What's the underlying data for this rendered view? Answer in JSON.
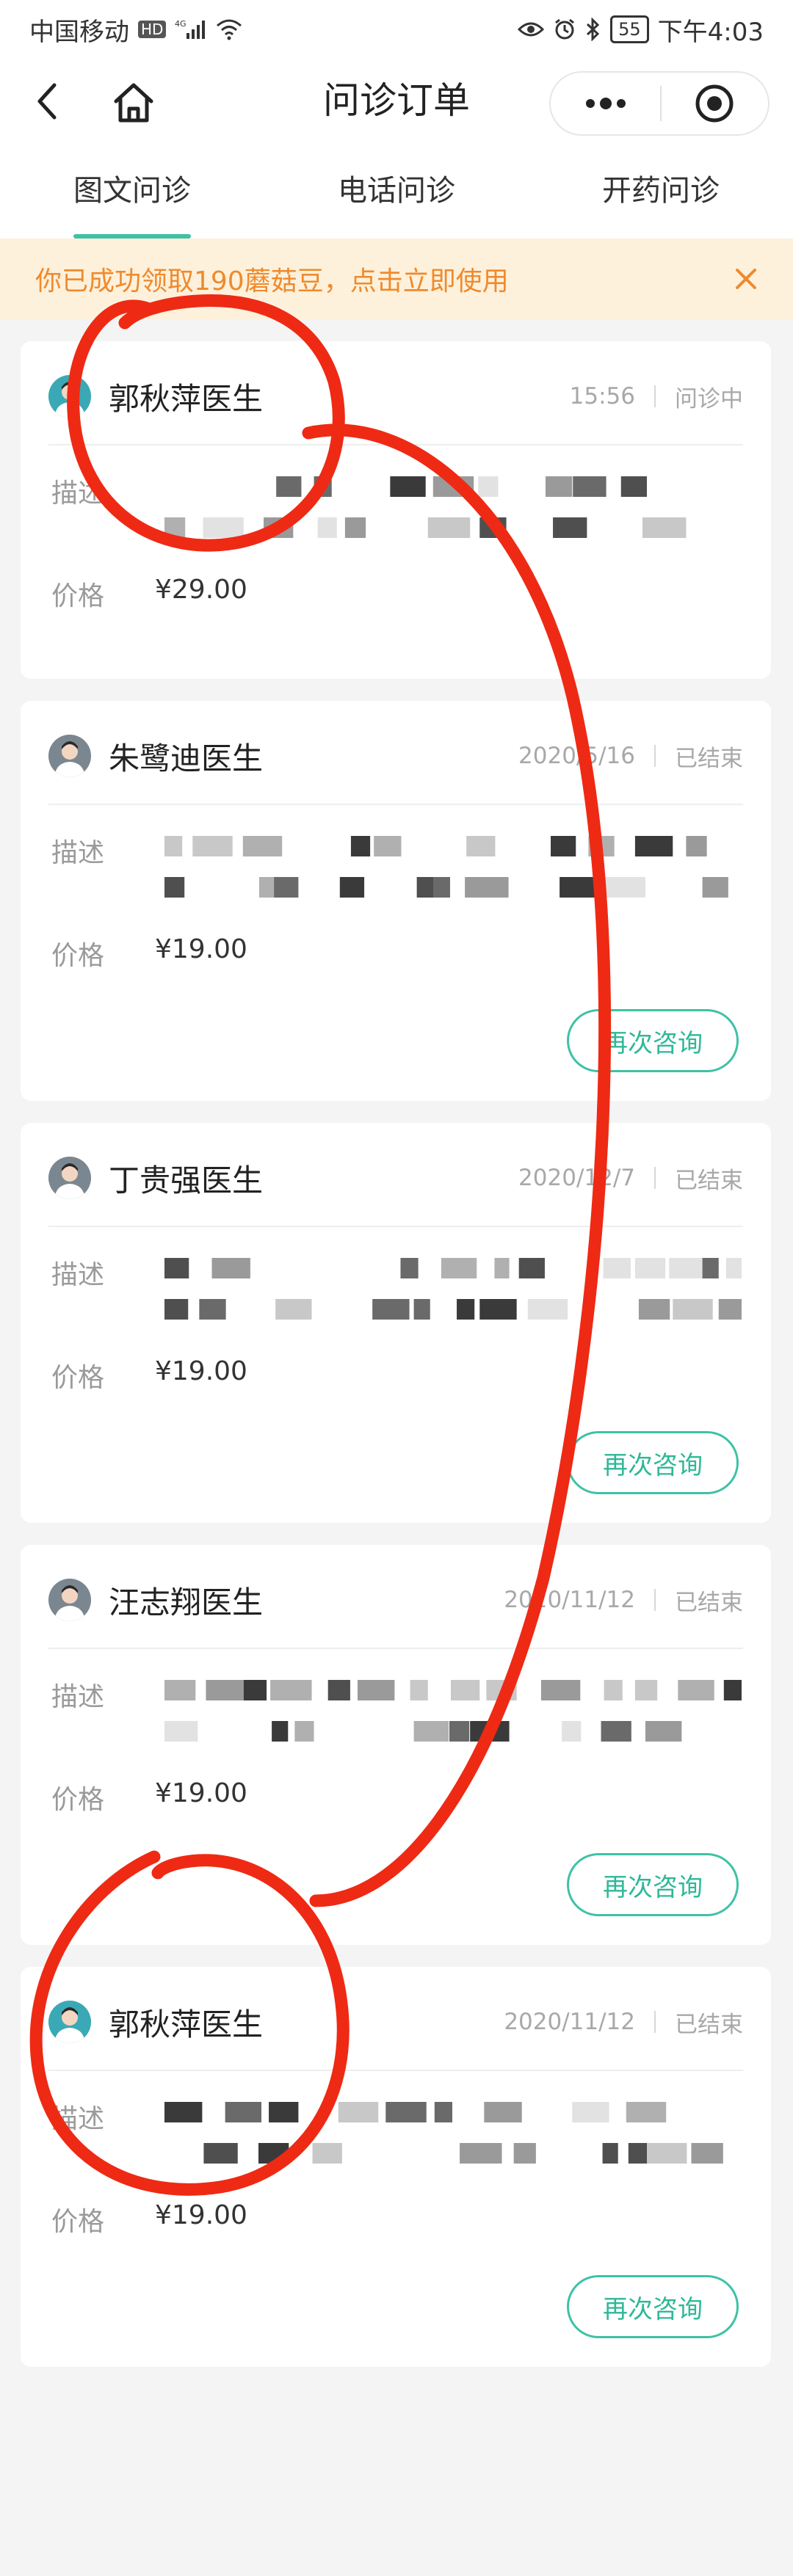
{
  "status_bar": {
    "carrier": "中国移动",
    "hd": "HD",
    "network": "4G",
    "battery": "55",
    "time": "下午4:03"
  },
  "nav": {
    "title": "问诊订单"
  },
  "tabs": [
    {
      "label": "图文问诊",
      "active": true
    },
    {
      "label": "电话问诊",
      "active": false
    },
    {
      "label": "开药问诊",
      "active": false
    }
  ],
  "promo": {
    "text": "你已成功领取190蘑菇豆，点击立即使用"
  },
  "labels": {
    "desc": "描述",
    "price": "价格",
    "reconsult": "再次咨询"
  },
  "orders": [
    {
      "doctor": "郭秋萍医生",
      "time": "15:56",
      "status": "问诊中",
      "price": "¥29.00",
      "show_button": false
    },
    {
      "doctor": "朱鹭迪医生",
      "time": "2020/5/16",
      "status": "已结束",
      "price": "¥19.00",
      "show_button": true
    },
    {
      "doctor": "丁贵强医生",
      "time": "2020/12/7",
      "status": "已结束",
      "price": "¥19.00",
      "show_button": true
    },
    {
      "doctor": "汪志翔医生",
      "time": "2020/11/12",
      "status": "已结束",
      "price": "¥19.00",
      "show_button": true
    },
    {
      "doctor": "郭秋萍医生",
      "time": "2020/11/12",
      "status": "已结束",
      "price": "¥19.00",
      "show_button": true
    }
  ],
  "colors": {
    "accent": "#3fc1a6",
    "promo_text": "#f08a2c",
    "promo_bg": "#fdf1dc",
    "annotation": "#ee2a14"
  }
}
